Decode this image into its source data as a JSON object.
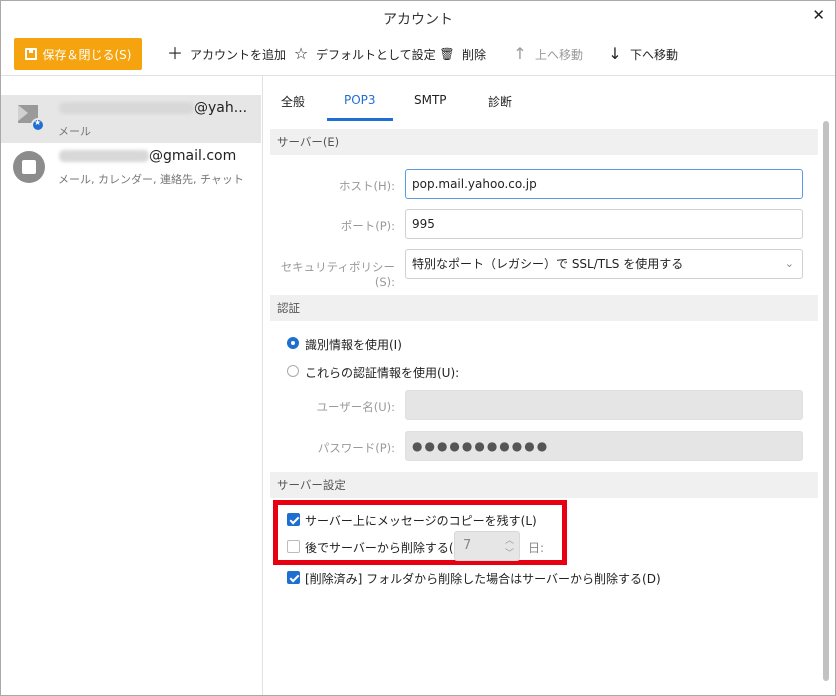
{
  "window": {
    "title": "アカウント",
    "close_label": "✕"
  },
  "toolbar": {
    "save_label": "保存＆閉じる(S)",
    "add_label": "アカウントを追加",
    "default_label": "デフォルトとして設定",
    "delete_label": "削除",
    "up_label": "上へ移動",
    "down_label": "下へ移動"
  },
  "sidebar": {
    "accounts": [
      {
        "name": "@yah...",
        "sub": "メール",
        "selected": true
      },
      {
        "name": "@gmail.com",
        "sub": "メール, カレンダー, 連絡先, チャット",
        "selected": false
      }
    ]
  },
  "tabs": [
    {
      "label": "全般",
      "active": false
    },
    {
      "label": "POP3",
      "active": true
    },
    {
      "label": "SMTP",
      "active": false
    },
    {
      "label": "診断",
      "active": false
    }
  ],
  "server": {
    "header": "サーバー(E)",
    "host_label": "ホスト(H):",
    "host_value": "pop.mail.yahoo.co.jp",
    "port_label": "ポート(P):",
    "port_value": "995",
    "security_label": "セキュリティポリシー(S):",
    "security_value": "特別なポート（レガシー）で SSL/TLS を使用する"
  },
  "auth": {
    "header": "認証",
    "use_identity_label": "識別情報を使用(I)",
    "use_identity_checked": true,
    "use_these_label": "これらの認証情報を使用(U):",
    "use_these_checked": false,
    "username_label": "ユーザー名(U):",
    "username_value": "",
    "password_label": "パスワード(P):",
    "password_value": "●●●●●●●●●●●"
  },
  "server_settings": {
    "header": "サーバー設定",
    "keep_copy_label": "サーバー上にメッセージのコピーを残す(L)",
    "keep_copy_checked": true,
    "delete_after_label": "後でサーバーから削除する(R)",
    "delete_after_checked": false,
    "days_value": "7",
    "days_unit": "日:",
    "delete_when_removed_label": "[削除済み] フォルダから削除した場合はサーバーから削除する(D)",
    "delete_when_removed_checked": true
  },
  "colors": {
    "accent": "#1f6fd1",
    "save_button": "#f5a30f",
    "highlight_box": "#e60012"
  }
}
